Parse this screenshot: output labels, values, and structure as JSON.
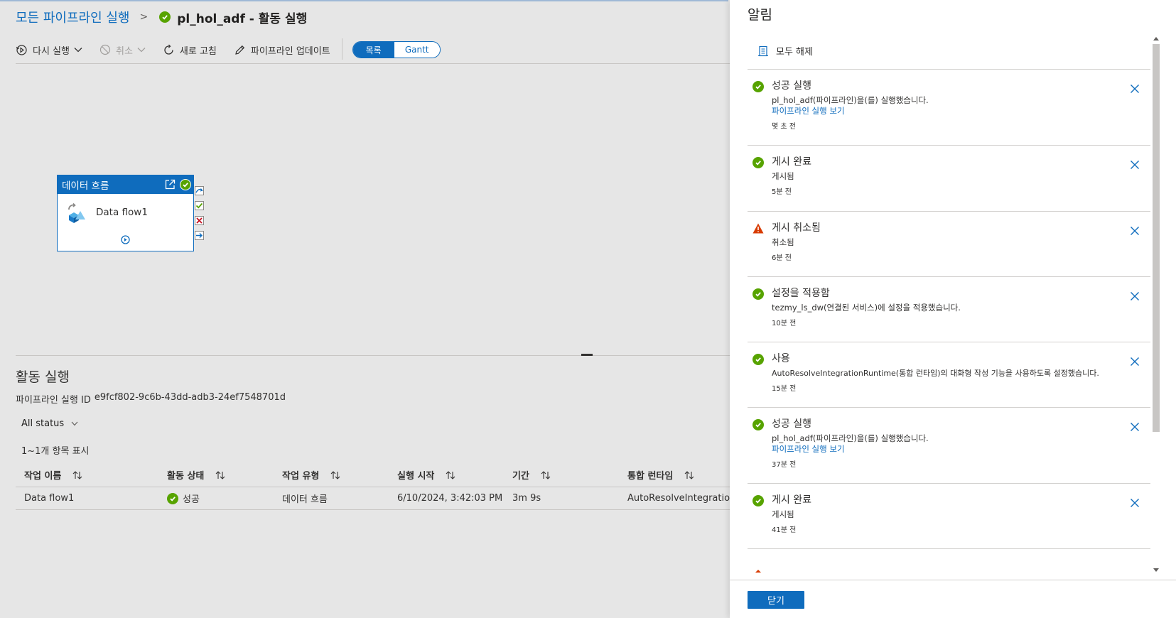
{
  "breadcrumb": {
    "parent": "모든 파이프라인 실행",
    "separator": ">",
    "current": "pl_hol_adf - 활동 실행"
  },
  "toolbar": {
    "rerun": "다시 실행",
    "cancel": "취소",
    "refresh": "새로 고침",
    "update_pipeline": "파이프라인 업데이트",
    "view_list": "목록",
    "view_gantt": "Gantt"
  },
  "activity_node": {
    "type_label": "데이터 흐름",
    "name": "Data flow1"
  },
  "activity_runs": {
    "title": "활동 실행",
    "run_id_label": "파이프라인 실행 ID",
    "run_id_value": "e9fcf802-9c6b-43dd-adb3-24ef7548701d",
    "status_filter": "All status",
    "count_text": "1~1개 항목 표시",
    "columns": [
      "작업 이름",
      "활동 상태",
      "작업 유형",
      "실행 시작",
      "기간",
      "통합 런타임"
    ],
    "rows": [
      {
        "name": "Data flow1",
        "status": "성공",
        "type": "데이터 흐름",
        "start": "6/10/2024, 3:42:03 PM",
        "duration": "3m 9s",
        "runtime": "AutoResolveIntegrationRuntime"
      }
    ]
  },
  "notifications": {
    "title": "알림",
    "clear_all": "모두 해제",
    "close_button": "닫기",
    "items": [
      {
        "status": "success",
        "title": "성공 실행",
        "message": "pl_hol_adf(파이프라인)을(를) 실행했습니다.",
        "link": "파이프라인 실행 보기",
        "time": "몇 초 전"
      },
      {
        "status": "success",
        "title": "게시 완료",
        "message": "게시됨",
        "link": "",
        "time": "5분 전"
      },
      {
        "status": "warning",
        "title": "게시 취소됨",
        "message": "취소됨",
        "link": "",
        "time": "6분 전"
      },
      {
        "status": "success",
        "title": "설정을 적용함",
        "message": "tezmy_ls_dw(연결된 서비스)에 설정을 적용했습니다.",
        "link": "",
        "time": "10분 전"
      },
      {
        "status": "success",
        "title": "사용",
        "message": "AutoResolveIntegrationRuntime(통합 런타임)의 대화형 작성 기능을 사용하도록 설정했습니다.",
        "link": "",
        "time": "15분 전"
      },
      {
        "status": "success",
        "title": "성공 실행",
        "message": "pl_hol_adf(파이프라인)을(를) 실행했습니다.",
        "link": "파이프라인 실행 보기",
        "time": "37분 전"
      },
      {
        "status": "success",
        "title": "게시 완료",
        "message": "게시됨",
        "link": "",
        "time": "41분 전"
      }
    ]
  },
  "colors": {
    "accent": "#0f6cbd",
    "success": "#57a300",
    "warning": "#d83b01",
    "error": "#c50f1f"
  }
}
